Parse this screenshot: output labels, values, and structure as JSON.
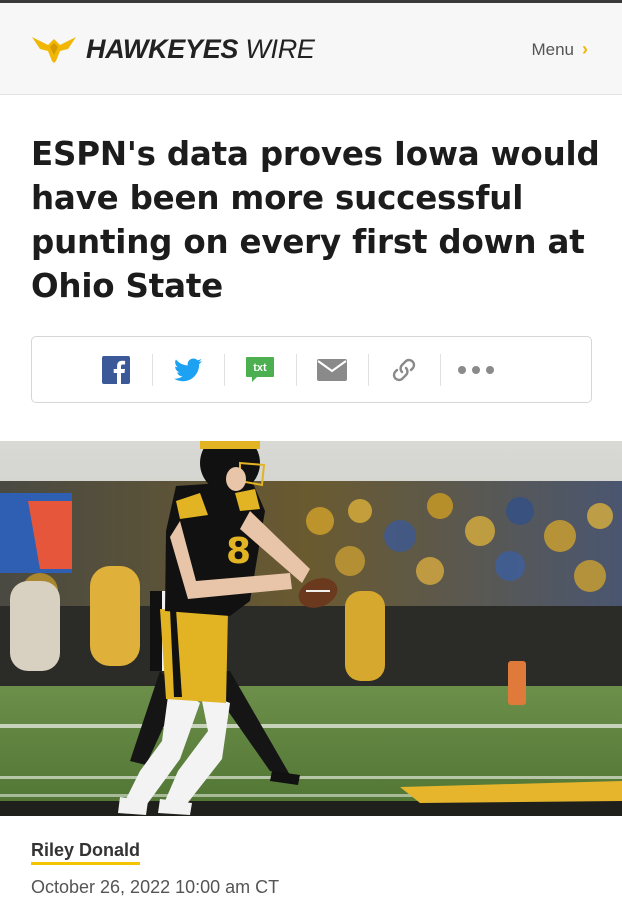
{
  "site": {
    "brand_bold": "HAWKEYES",
    "brand_light": "WIRE",
    "menu_label": "Menu",
    "accent_color": "#f2b705"
  },
  "article": {
    "headline": "ESPN's data proves Iowa would have been more successful punting on every first down at Ohio State",
    "author": "Riley Donald",
    "date": "October 26, 2022 10:00 am CT"
  },
  "share": {
    "buttons": [
      {
        "icon": "facebook-icon",
        "color": "#3b5998"
      },
      {
        "icon": "twitter-icon",
        "color": "#1da1f2"
      },
      {
        "icon": "sms-icon",
        "label": "txt",
        "color": "#4caf50"
      },
      {
        "icon": "email-icon",
        "color": "#8a8a8a"
      },
      {
        "icon": "link-icon",
        "color": "#8a8a8a"
      },
      {
        "icon": "more-icon",
        "color": "#8a8a8a"
      }
    ]
  },
  "hero_image": {
    "jersey_number": "8",
    "description_icon": "football-photo"
  }
}
